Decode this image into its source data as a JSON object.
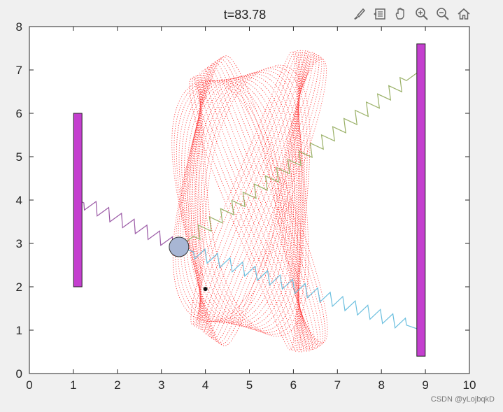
{
  "toolbar": {
    "icons": [
      "brush-icon",
      "legend-icon",
      "pan-hand-icon",
      "zoom-in-icon",
      "zoom-out-icon",
      "home-icon"
    ]
  },
  "watermark": "CSDN @yLojbqkD",
  "chart_data": {
    "type": "line",
    "title": "t=83.78",
    "xlabel": "",
    "ylabel": "",
    "xlim": [
      0,
      10
    ],
    "ylim": [
      0,
      8
    ],
    "xticks": [
      0,
      1,
      2,
      3,
      4,
      5,
      6,
      7,
      8,
      9,
      10
    ],
    "yticks": [
      0,
      1,
      2,
      3,
      4,
      5,
      6,
      7,
      8
    ],
    "grid": false,
    "walls": [
      {
        "x": 1.1,
        "y_bottom": 2.0,
        "y_top": 6.0,
        "color": "#c43fcf"
      },
      {
        "x": 8.9,
        "y_bottom": 0.4,
        "y_top": 7.6,
        "color": "#c43fcf"
      }
    ],
    "ball": {
      "x": 3.4,
      "y": 2.92,
      "color": "#a8b6d4"
    },
    "trajectory_dots": {
      "color": "#ff2222",
      "x_range": [
        3.0,
        7.0
      ],
      "y_range": [
        0.5,
        7.45
      ]
    },
    "marker_point": {
      "x": 4.0,
      "y": 1.95
    },
    "springs": [
      {
        "from": [
          1.1,
          4.0
        ],
        "to": [
          3.4,
          2.92
        ],
        "color": "#9b5aa6"
      },
      {
        "from": [
          3.4,
          2.92
        ],
        "to": [
          8.9,
          7.0
        ],
        "color": "#99b066"
      },
      {
        "from": [
          3.4,
          2.92
        ],
        "to": [
          8.9,
          1.0
        ],
        "color": "#6bbfdf"
      }
    ]
  }
}
